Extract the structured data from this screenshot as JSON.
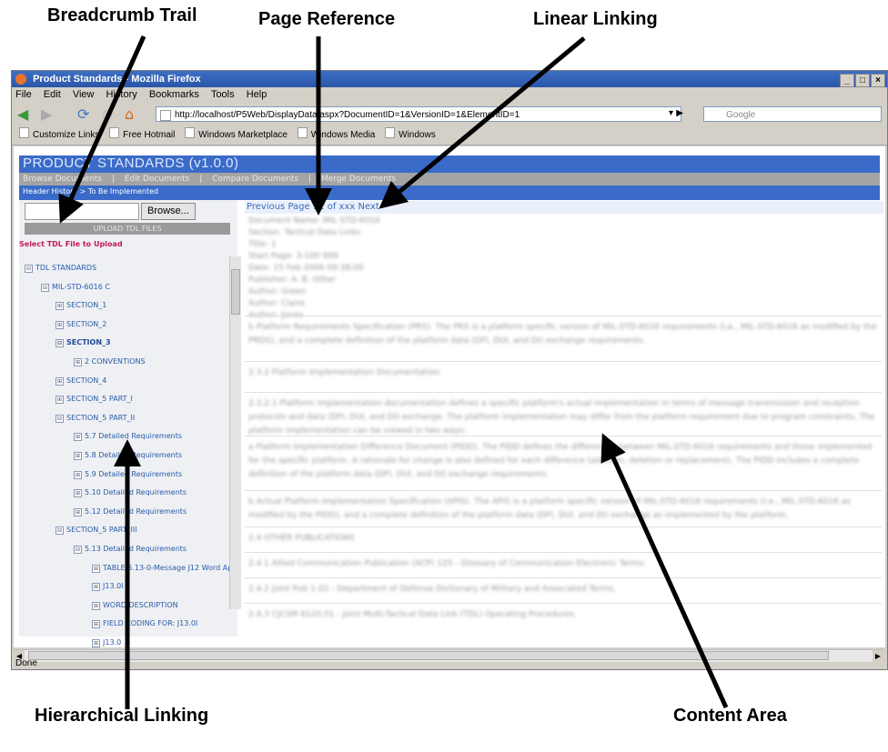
{
  "callouts": {
    "breadcrumb_trail": "Breadcrumb Trail",
    "page_reference": "Page Reference",
    "linear_linking": "Linear Linking",
    "hierarchical_linking": "Hierarchical Linking",
    "content_area": "Content Area"
  },
  "browser": {
    "title": "Product Standards - Mozilla Firefox",
    "window_controls": [
      "_",
      "□",
      "×"
    ],
    "menu": [
      "File",
      "Edit",
      "View",
      "History",
      "Bookmarks",
      "Tools",
      "Help"
    ],
    "url": "http://localhost/P5Web/DisplayData.aspx?DocumentID=1&VersionID=1&ElementID=1",
    "search_placeholder": "Google",
    "bookmarks": [
      "Customize Links",
      "Free Hotmail",
      "Windows Marketplace",
      "Windows Media",
      "Windows"
    ],
    "status": "Done"
  },
  "app": {
    "title": "PRODUCT STANDARDS (v1.0.0)",
    "nav": [
      "Browse Documents",
      "|",
      "Edit Documents",
      "|",
      "Compare Documents",
      "|",
      "Merge Documents"
    ],
    "breadcrumb": "Header History > To Be Implemented",
    "browse_label": "Browse...",
    "upload_label": "UPLOAD TDL FILES",
    "select_label": "Select TDL File to Upload"
  },
  "tree": [
    {
      "label": "TDL STANDARDS",
      "sign": "⊟"
    },
    {
      "label": "MIL-STD-6016 C",
      "sign": "⊟"
    },
    {
      "label": "SECTION_1",
      "sign": "⊞"
    },
    {
      "label": "SECTION_2",
      "sign": "⊞"
    },
    {
      "label": "SECTION_3",
      "sign": "⊟"
    },
    {
      "label": "2 CONVENTIONS",
      "sign": "⊞"
    },
    {
      "label": "SECTION_4",
      "sign": "⊞"
    },
    {
      "label": "SECTION_5 PART_I",
      "sign": "⊞"
    },
    {
      "label": "SECTION_5 PART_II",
      "sign": "⊟"
    },
    {
      "label": "5.7 Detailed Requirements",
      "sign": "⊞"
    },
    {
      "label": "5.8 Detailed Requirements",
      "sign": "⊞"
    },
    {
      "label": "5.9 Detailed Requirements",
      "sign": "⊞"
    },
    {
      "label": "5.10 Detailed Requirements",
      "sign": "⊞"
    },
    {
      "label": "5.12 Detailed Requirements",
      "sign": "⊞"
    },
    {
      "label": "SECTION_5 PART_III",
      "sign": "⊟"
    },
    {
      "label": "5.13 Detailed Requirements",
      "sign": "⊟"
    },
    {
      "label": "TABLE 5.13-0-Message J12 Word App",
      "sign": "⊞"
    },
    {
      "label": "J13.0I",
      "sign": "⊞"
    },
    {
      "label": "WORD DESCRIPTION",
      "sign": "⊞"
    },
    {
      "label": "FIELD CODING FOR: J13.0I",
      "sign": "⊞"
    },
    {
      "label": "J13.0",
      "sign": "⊞"
    }
  ],
  "content": {
    "page_nav": "Previous Page 11 of xxx Next",
    "meta_lines": [
      "Document Name: MIL-STD-6016",
      "Section: Tactical Data Links",
      "Title: 1",
      "Start Page: 3-100 999",
      "Date: 15 Feb 2006 09:38:00",
      "Publisher: A. B. Other",
      "Author: Green",
      "Author: Claire",
      "Author: Jones"
    ],
    "paragraphs": [
      "b Platform Requirements Specification (PRS). The PRS is a platform specific version of MIL-STD-6016 requirements (i.e., MIL-STD-6016 as modified by the PRDS), and a complete definition of the platform data (DFI, DUI, and DI) exchange requirements.",
      "2.3.2 Platform Implementation Documentation",
      "2.3.2.1 Platform implementation documentation defines a specific platform's actual implementation in terms of message transmission and reception protocols and data (DFI, DUI, and DI) exchange. The platform implementation may differ from the platform requirement due to program constraints. The platform implementation can be viewed in two ways:",
      "a Platform Implementation Difference Document (PIDD). The PIDD defines the differences between MIL-STD-6016 requirements and those implemented for the specific platform. A rationale for change is also defined for each difference (addition, deletion or replacement). The PIDD includes a complete definition of the platform data (DFI, DUI, and DI) exchange requirements.",
      "b Actual Platform Implementation Specification (APIS). The APIS is a platform specific version of MIL-STD-6016 requirements (i.e., MIL-STD-6016 as modified by the PIDD), and a complete definition of the platform data (DFI, DUI, and DI) exchange as implemented by the platform.",
      "2.4 OTHER PUBLICATIONS",
      "2.4.1 Allied Communication Publication (ACP) 125 - Glossary of Communication Electronic Terms.",
      "2.4.2 Joint Pub 1-02 - Department of Defense Dictionary of Military and Associated Terms.",
      "2.4.3 CJCSM 6120.01 - Joint Multi-Tactical Data Link (TDL) Operating Procedures."
    ]
  },
  "colors": {
    "app_header": "#3a6bc9",
    "nav_bar": "#a4a4a4",
    "link_blue": "#2a5caa",
    "select_label": "#c2185b"
  }
}
